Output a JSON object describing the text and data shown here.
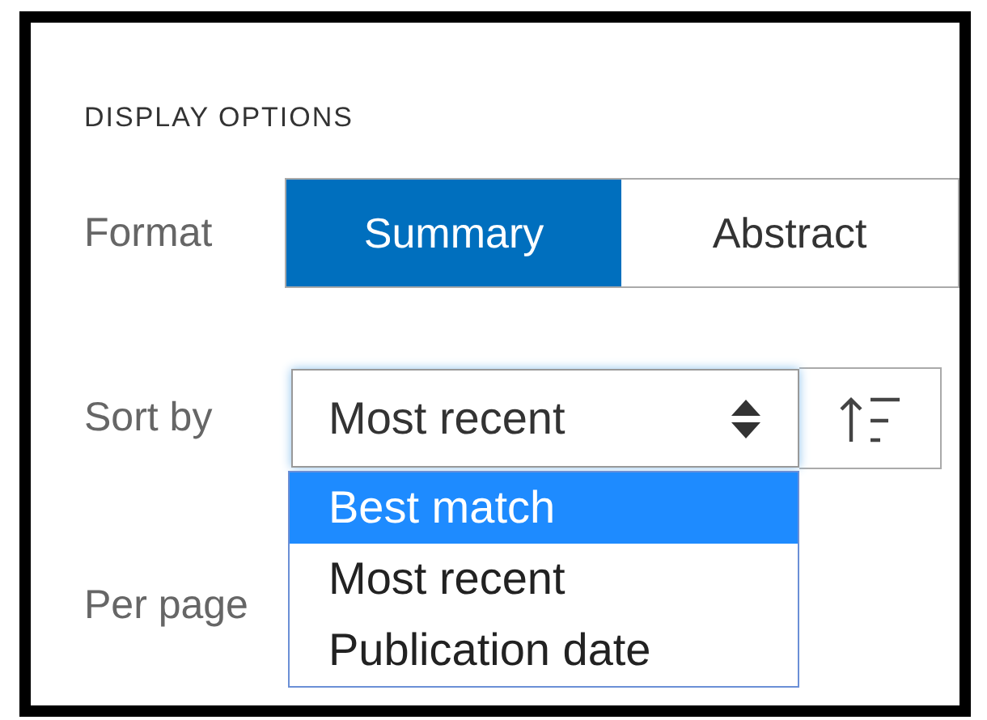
{
  "title": "DISPLAY OPTIONS",
  "format": {
    "label": "Format",
    "options": [
      {
        "label": "Summary",
        "selected": true
      },
      {
        "label": "Abstract",
        "selected": false
      }
    ]
  },
  "sort": {
    "label": "Sort by",
    "value": "Most recent",
    "expanded": true,
    "options": [
      {
        "label": "Best match",
        "highlighted": true
      },
      {
        "label": "Most recent",
        "highlighted": false
      },
      {
        "label": "Publication date",
        "highlighted": false
      }
    ]
  },
  "per_page": {
    "label": "Per page"
  }
}
